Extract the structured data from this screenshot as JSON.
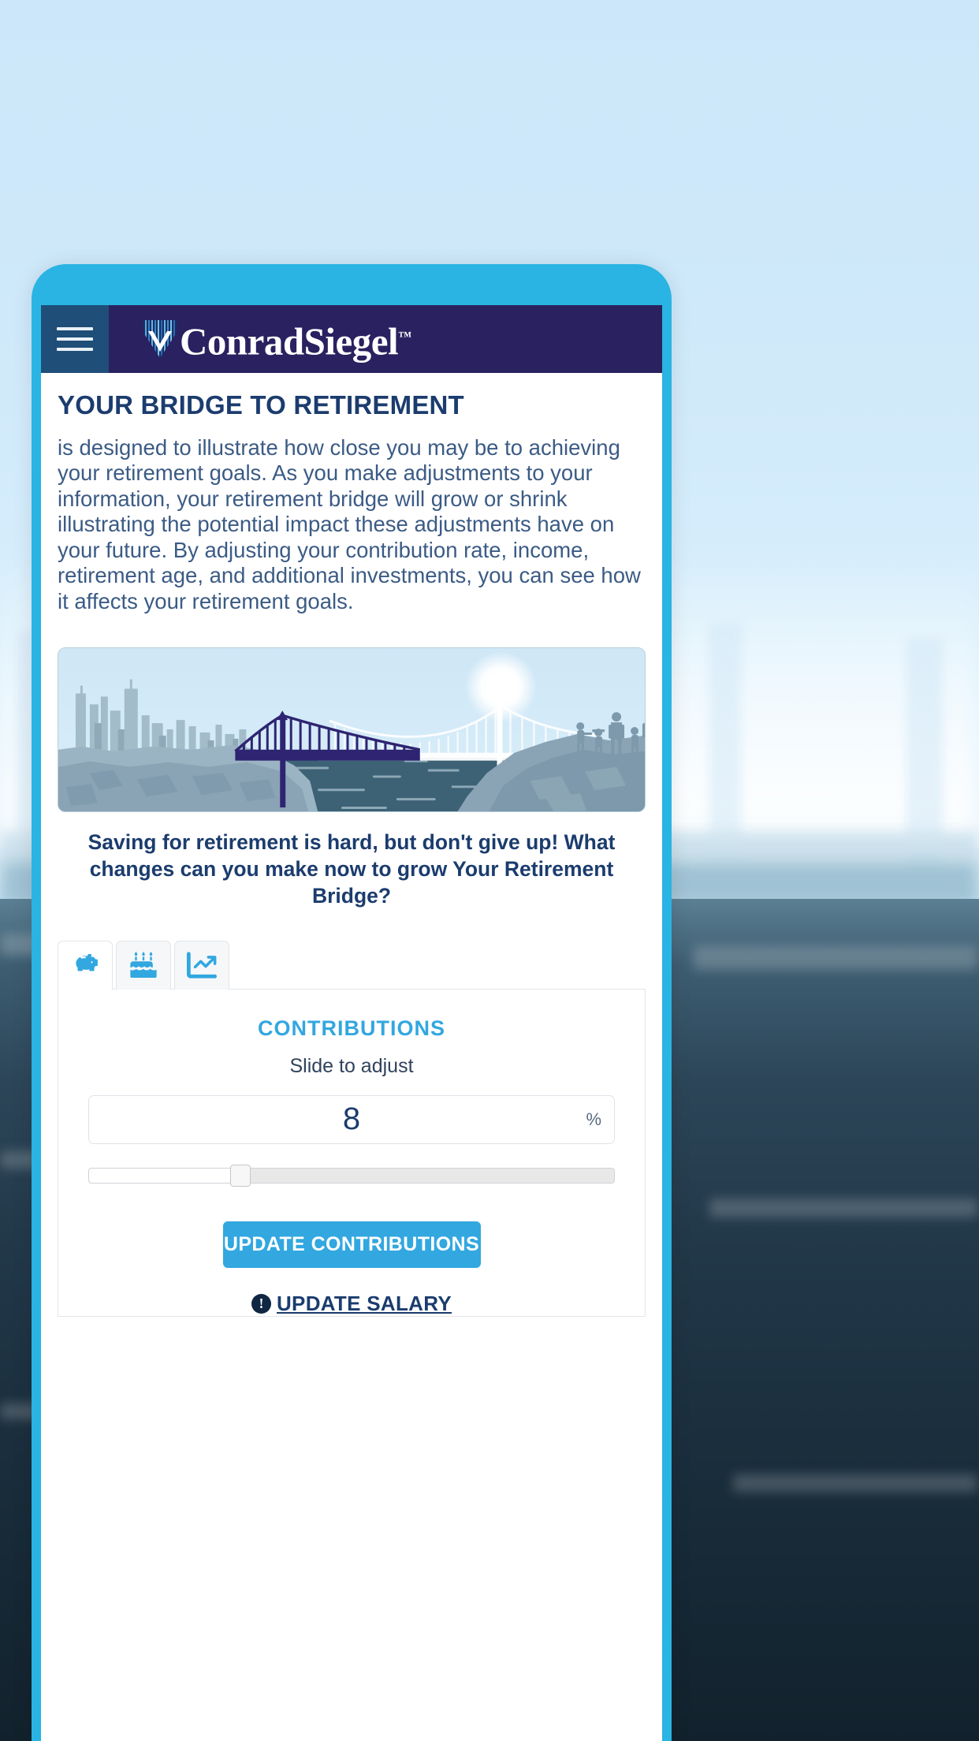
{
  "backdrop": {
    "note": "blurred bridge-over-water photo"
  },
  "appbar": {
    "menu_icon": "hamburger-menu-icon",
    "brand_name": "ConradSiegel",
    "brand_tm": "™",
    "brand_mark": "conrad-siegel-logo-mark"
  },
  "content": {
    "title": "YOUR BRIDGE TO RETIREMENT",
    "intro": "is designed to illustrate how close you may be to achieving your retirement goals. As you make adjustments to your information, your retirement bridge will grow or shrink illustrating the potential impact these adjustments have on your future. By adjusting your contribution rate, income, retirement age, and additional investments, you can see how it affects your retirement goals.",
    "illustration_name": "retirement-bridge-illustration",
    "caption": "Saving for retirement is hard, but don't give up! What changes can you make now to grow Your Retirement Bridge?"
  },
  "tabs": [
    {
      "id": "contributions",
      "icon": "piggy-bank-icon",
      "active": true
    },
    {
      "id": "retirement-age",
      "icon": "birthday-cake-icon",
      "active": false
    },
    {
      "id": "investments",
      "icon": "chart-line-icon",
      "active": false
    }
  ],
  "panel": {
    "title": "CONTRIBUTIONS",
    "subtitle": "Slide to adjust",
    "value": "8",
    "unit": "%",
    "slider": {
      "value": 8,
      "min": 0,
      "max": 30,
      "percent": 27
    },
    "cta_label": "UPDATE CONTRIBUTIONS",
    "link_icon": "info-circle-icon",
    "link_label": " UPDATE SALARY"
  },
  "colors": {
    "brand_navy": "#2a2160",
    "brand_blue": "#32a7e0",
    "accent_cyan": "#29b4e3",
    "title_navy": "#1b3c6e",
    "body_blue": "#3b5b85"
  }
}
